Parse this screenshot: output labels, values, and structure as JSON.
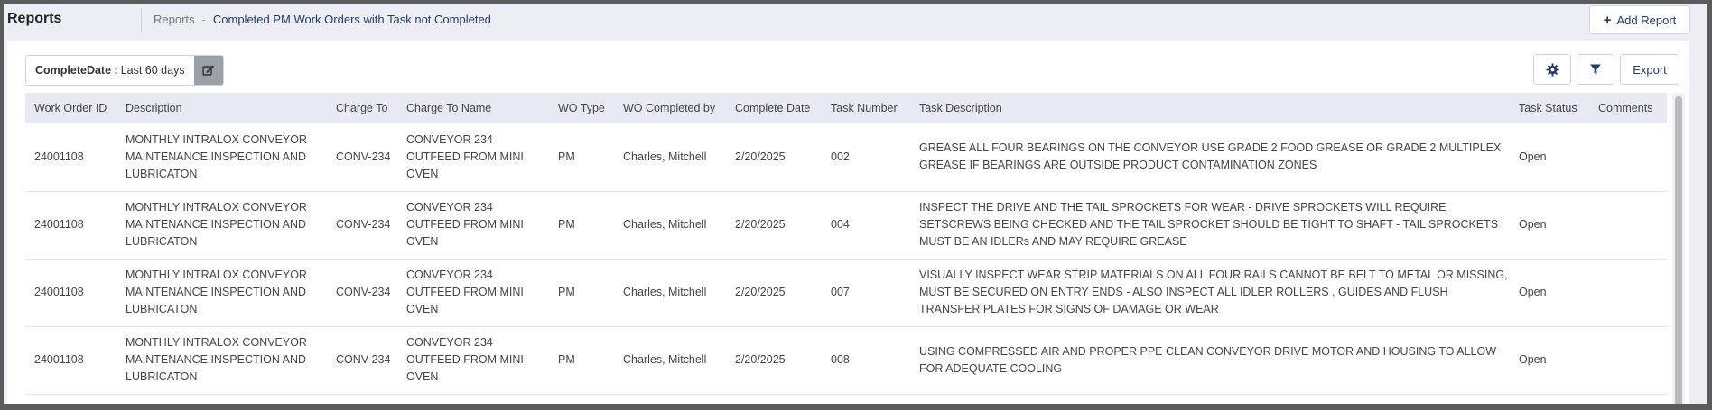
{
  "header": {
    "title": "Reports",
    "breadcrumb_root": "Reports",
    "breadcrumb_separator": "-",
    "breadcrumb_current": "Completed PM Work Orders with Task not Completed",
    "add_report_label": "Add Report"
  },
  "filter": {
    "field": "CompleteDate :",
    "value": "Last 60 days"
  },
  "toolbar": {
    "export_label": "Export"
  },
  "table": {
    "columns": [
      "Work Order ID",
      "Description",
      "Charge To",
      "Charge To Name",
      "WO Type",
      "WO Completed by",
      "Complete Date",
      "Task Number",
      "Task Description",
      "Task Status",
      "Comments"
    ],
    "rows": [
      {
        "work_order_id": "24001108",
        "description": "MONTHLY INTRALOX CONVEYOR MAINTENANCE INSPECTION AND LUBRICATON",
        "charge_to": "CONV-234",
        "charge_to_name": "CONVEYOR 234 OUTFEED FROM MINI OVEN",
        "wo_type": "PM",
        "completed_by": "Charles, Mitchell",
        "complete_date": "2/20/2025",
        "task_number": "002",
        "task_description": "GREASE ALL FOUR BEARINGS ON THE CONVEYOR USE GRADE 2 FOOD GREASE OR GRADE 2 MULTIPLEX GREASE IF BEARINGS ARE OUTSIDE PRODUCT CONTAMINATION ZONES",
        "task_status": "Open",
        "comments": ""
      },
      {
        "work_order_id": "24001108",
        "description": "MONTHLY INTRALOX CONVEYOR MAINTENANCE INSPECTION AND LUBRICATON",
        "charge_to": "CONV-234",
        "charge_to_name": "CONVEYOR 234 OUTFEED FROM MINI OVEN",
        "wo_type": "PM",
        "completed_by": "Charles, Mitchell",
        "complete_date": "2/20/2025",
        "task_number": "004",
        "task_description": "INSPECT THE DRIVE AND THE TAIL SPROCKETS FOR WEAR - DRIVE SPROCKETS WILL REQUIRE SETSCREWS BEING CHECKED AND THE TAIL SPROCKET SHOULD BE TIGHT TO SHAFT - TAIL SPROCKETS MUST BE AN IDLERs AND MAY REQUIRE GREASE",
        "task_status": "Open",
        "comments": ""
      },
      {
        "work_order_id": "24001108",
        "description": "MONTHLY INTRALOX CONVEYOR MAINTENANCE INSPECTION AND LUBRICATON",
        "charge_to": "CONV-234",
        "charge_to_name": "CONVEYOR 234 OUTFEED FROM MINI OVEN",
        "wo_type": "PM",
        "completed_by": "Charles, Mitchell",
        "complete_date": "2/20/2025",
        "task_number": "007",
        "task_description": "VISUALLY INSPECT WEAR STRIP MATERIALS ON ALL FOUR RAILS CANNOT BE BELT TO METAL OR MISSING, MUST BE SECURED ON ENTRY ENDS - ALSO INSPECT ALL IDLER ROLLERS , GUIDES AND FLUSH TRANSFER PLATES FOR SIGNS OF DAMAGE OR WEAR",
        "task_status": "Open",
        "comments": ""
      },
      {
        "work_order_id": "24001108",
        "description": "MONTHLY INTRALOX CONVEYOR MAINTENANCE INSPECTION AND LUBRICATON",
        "charge_to": "CONV-234",
        "charge_to_name": "CONVEYOR 234 OUTFEED FROM MINI OVEN",
        "wo_type": "PM",
        "completed_by": "Charles, Mitchell",
        "complete_date": "2/20/2025",
        "task_number": "008",
        "task_description": "USING COMPRESSED AIR AND PROPER PPE CLEAN CONVEYOR DRIVE MOTOR AND HOUSING TO ALLOW FOR ADEQUATE COOLING",
        "task_status": "Open",
        "comments": ""
      }
    ]
  },
  "icons": {
    "edit": "edit-icon",
    "settings": "gear-icon",
    "filter": "filter-icon",
    "add": "plus-icon"
  },
  "colors": {
    "accent": "#1f3c70",
    "header_bg": "#e9e9f3",
    "edit_button_bg": "#9aa0a8"
  }
}
